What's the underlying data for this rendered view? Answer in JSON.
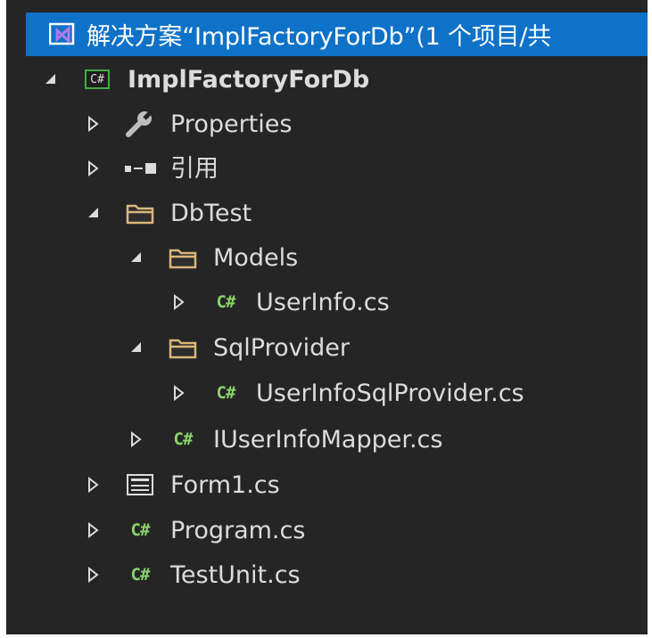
{
  "solution": {
    "title": "解决方案“ImplFactoryForDb”(1 个项目/共",
    "icon": "visual-studio-solution-icon"
  },
  "project": {
    "label": "ImplFactoryForDb",
    "icon": "csharp-project-icon",
    "badge": "C#"
  },
  "items": {
    "properties": {
      "label": "Properties",
      "icon": "wrench-icon"
    },
    "references": {
      "label": "引用",
      "icon": "references-icon"
    },
    "dbtest": {
      "label": "DbTest",
      "icon": "folder-icon"
    },
    "models": {
      "label": "Models",
      "icon": "folder-icon"
    },
    "userinfo": {
      "label": "UserInfo.cs",
      "icon": "csharp-file-icon"
    },
    "sqlprovider": {
      "label": "SqlProvider",
      "icon": "folder-icon"
    },
    "userinfosqlprovider": {
      "label": "UserInfoSqlProvider.cs",
      "icon": "csharp-file-icon"
    },
    "iuserinfomapper": {
      "label": "IUserInfoMapper.cs",
      "icon": "csharp-file-icon"
    },
    "form1": {
      "label": "Form1.cs",
      "icon": "form-icon"
    },
    "program": {
      "label": "Program.cs",
      "icon": "csharp-file-icon"
    },
    "testunit": {
      "label": "TestUnit.cs",
      "icon": "csharp-file-icon"
    }
  },
  "csharp_badge": "C#",
  "colors": {
    "panel_bg": "#252526",
    "selection": "#0e72c8",
    "text": "#dcdcdc",
    "csharp_green": "#8bd36a",
    "folder": "#dcb67a"
  }
}
